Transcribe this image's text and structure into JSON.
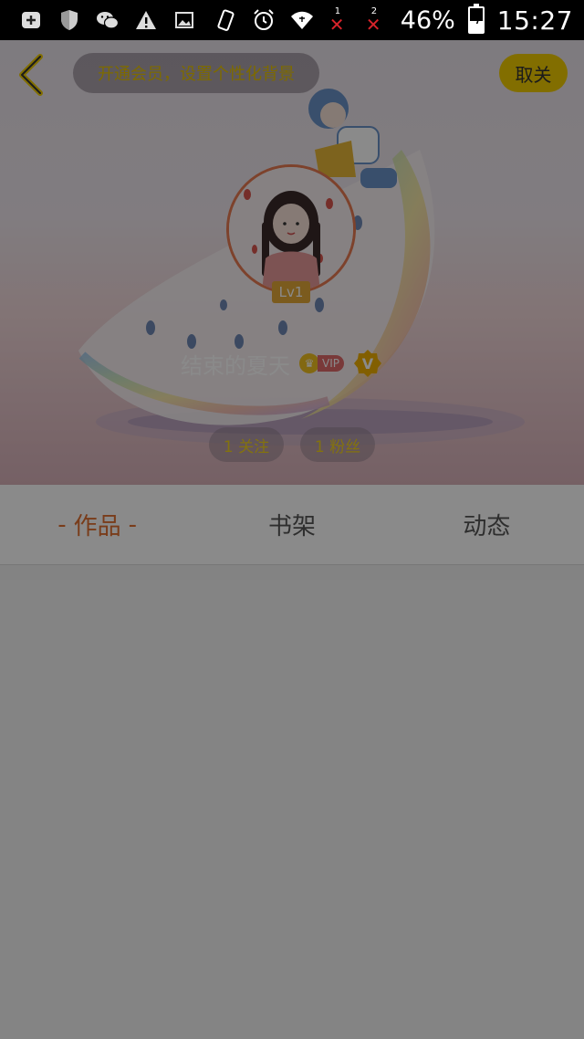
{
  "status_bar": {
    "battery_percent": "46%",
    "time": "15:27",
    "sim1_label": "1",
    "sim2_label": "2",
    "icons": [
      "plus-box-icon",
      "shield-icon",
      "wechat-icon",
      "warning-icon",
      "image-icon",
      "rotate-icon",
      "alarm-icon",
      "wifi-icon",
      "sim-x-icon",
      "sim-x-icon",
      "battery-charging-icon"
    ]
  },
  "header": {
    "vip_banner": "开通会员，设置个性化背景",
    "cancel_label": "取关",
    "level": "Lv1",
    "username": "结束的夏天",
    "vip_label": "VIP",
    "v_badge": "V",
    "follow": "1 关注",
    "fans": "1 粉丝"
  },
  "tabs": [
    {
      "label": "作品",
      "active": true
    },
    {
      "label": "书架",
      "active": false
    },
    {
      "label": "动态",
      "active": false
    }
  ],
  "tab_active_marker": "-",
  "colors": {
    "accent": "#e07030",
    "yellow": "#f0cc00",
    "level_badge": "#e3a838",
    "avatar_border": "#e87a52"
  }
}
